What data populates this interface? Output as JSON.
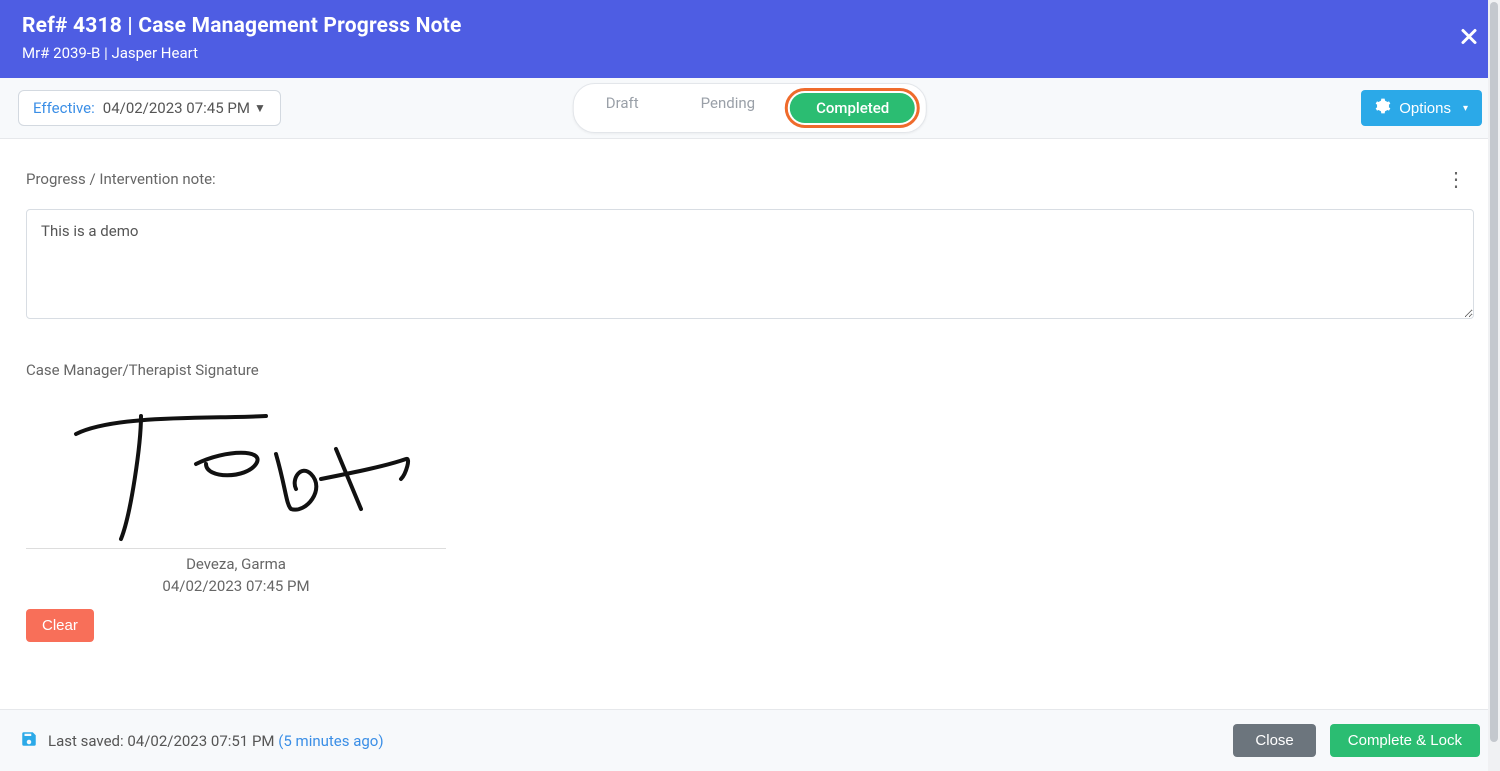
{
  "header": {
    "title": "Ref# 4318 | Case Management Progress Note",
    "subtitle": "Mr# 2039-B | Jasper Heart",
    "close_icon": "close"
  },
  "toolbar": {
    "effective_label": "Effective:",
    "effective_value": "04/02/2023 07:45 PM",
    "status": {
      "draft": "Draft",
      "pending": "Pending",
      "completed": "Completed",
      "active": "completed"
    },
    "options_label": "Options"
  },
  "note": {
    "label": "Progress / Intervention note:",
    "value": "This is a demo"
  },
  "signature": {
    "label": "Case Manager/Therapist Signature",
    "signer_name": "Deveza, Garma",
    "signed_at": "04/02/2023 07:45 PM",
    "clear_label": "Clear"
  },
  "footer": {
    "last_saved_prefix": "Last saved: ",
    "last_saved_time": "04/02/2023 07:51 PM",
    "last_saved_ago": " (5 minutes ago)",
    "close_label": "Close",
    "complete_lock_label": "Complete & Lock"
  }
}
